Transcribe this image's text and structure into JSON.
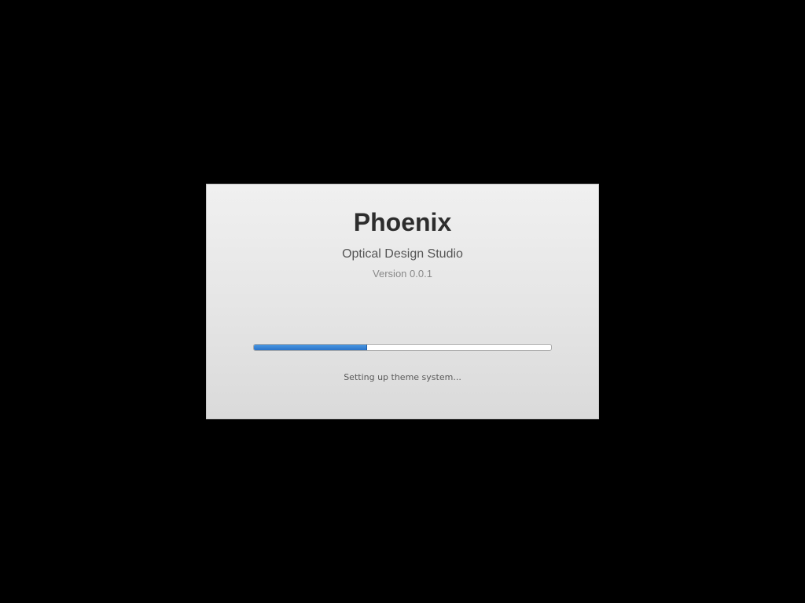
{
  "splash": {
    "app_name": "Phoenix",
    "subtitle": "Optical Design Studio",
    "version": "Version 0.0.1",
    "progress": {
      "fraction": 0.38,
      "color": "#2f7fd6"
    },
    "status": "Setting up theme system..."
  },
  "colors": {
    "background": "#000000",
    "panel": "#e6e6e6",
    "accent": "#2f7fd6"
  }
}
